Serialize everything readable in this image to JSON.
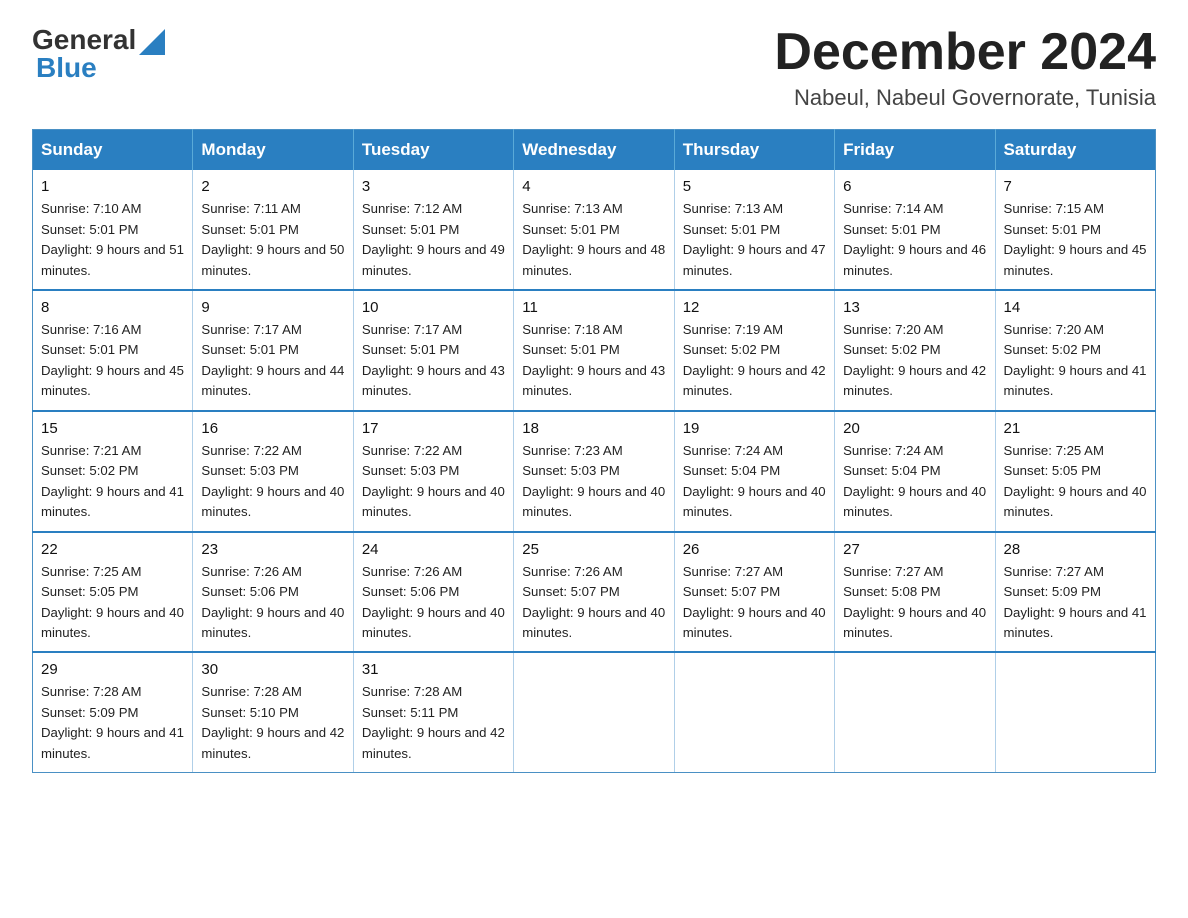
{
  "logo": {
    "text_general": "General",
    "text_blue": "Blue"
  },
  "header": {
    "month_year": "December 2024",
    "location": "Nabeul, Nabeul Governorate, Tunisia"
  },
  "days_of_week": [
    "Sunday",
    "Monday",
    "Tuesday",
    "Wednesday",
    "Thursday",
    "Friday",
    "Saturday"
  ],
  "weeks": [
    [
      {
        "day": "1",
        "sunrise": "Sunrise: 7:10 AM",
        "sunset": "Sunset: 5:01 PM",
        "daylight": "Daylight: 9 hours and 51 minutes."
      },
      {
        "day": "2",
        "sunrise": "Sunrise: 7:11 AM",
        "sunset": "Sunset: 5:01 PM",
        "daylight": "Daylight: 9 hours and 50 minutes."
      },
      {
        "day": "3",
        "sunrise": "Sunrise: 7:12 AM",
        "sunset": "Sunset: 5:01 PM",
        "daylight": "Daylight: 9 hours and 49 minutes."
      },
      {
        "day": "4",
        "sunrise": "Sunrise: 7:13 AM",
        "sunset": "Sunset: 5:01 PM",
        "daylight": "Daylight: 9 hours and 48 minutes."
      },
      {
        "day": "5",
        "sunrise": "Sunrise: 7:13 AM",
        "sunset": "Sunset: 5:01 PM",
        "daylight": "Daylight: 9 hours and 47 minutes."
      },
      {
        "day": "6",
        "sunrise": "Sunrise: 7:14 AM",
        "sunset": "Sunset: 5:01 PM",
        "daylight": "Daylight: 9 hours and 46 minutes."
      },
      {
        "day": "7",
        "sunrise": "Sunrise: 7:15 AM",
        "sunset": "Sunset: 5:01 PM",
        "daylight": "Daylight: 9 hours and 45 minutes."
      }
    ],
    [
      {
        "day": "8",
        "sunrise": "Sunrise: 7:16 AM",
        "sunset": "Sunset: 5:01 PM",
        "daylight": "Daylight: 9 hours and 45 minutes."
      },
      {
        "day": "9",
        "sunrise": "Sunrise: 7:17 AM",
        "sunset": "Sunset: 5:01 PM",
        "daylight": "Daylight: 9 hours and 44 minutes."
      },
      {
        "day": "10",
        "sunrise": "Sunrise: 7:17 AM",
        "sunset": "Sunset: 5:01 PM",
        "daylight": "Daylight: 9 hours and 43 minutes."
      },
      {
        "day": "11",
        "sunrise": "Sunrise: 7:18 AM",
        "sunset": "Sunset: 5:01 PM",
        "daylight": "Daylight: 9 hours and 43 minutes."
      },
      {
        "day": "12",
        "sunrise": "Sunrise: 7:19 AM",
        "sunset": "Sunset: 5:02 PM",
        "daylight": "Daylight: 9 hours and 42 minutes."
      },
      {
        "day": "13",
        "sunrise": "Sunrise: 7:20 AM",
        "sunset": "Sunset: 5:02 PM",
        "daylight": "Daylight: 9 hours and 42 minutes."
      },
      {
        "day": "14",
        "sunrise": "Sunrise: 7:20 AM",
        "sunset": "Sunset: 5:02 PM",
        "daylight": "Daylight: 9 hours and 41 minutes."
      }
    ],
    [
      {
        "day": "15",
        "sunrise": "Sunrise: 7:21 AM",
        "sunset": "Sunset: 5:02 PM",
        "daylight": "Daylight: 9 hours and 41 minutes."
      },
      {
        "day": "16",
        "sunrise": "Sunrise: 7:22 AM",
        "sunset": "Sunset: 5:03 PM",
        "daylight": "Daylight: 9 hours and 40 minutes."
      },
      {
        "day": "17",
        "sunrise": "Sunrise: 7:22 AM",
        "sunset": "Sunset: 5:03 PM",
        "daylight": "Daylight: 9 hours and 40 minutes."
      },
      {
        "day": "18",
        "sunrise": "Sunrise: 7:23 AM",
        "sunset": "Sunset: 5:03 PM",
        "daylight": "Daylight: 9 hours and 40 minutes."
      },
      {
        "day": "19",
        "sunrise": "Sunrise: 7:24 AM",
        "sunset": "Sunset: 5:04 PM",
        "daylight": "Daylight: 9 hours and 40 minutes."
      },
      {
        "day": "20",
        "sunrise": "Sunrise: 7:24 AM",
        "sunset": "Sunset: 5:04 PM",
        "daylight": "Daylight: 9 hours and 40 minutes."
      },
      {
        "day": "21",
        "sunrise": "Sunrise: 7:25 AM",
        "sunset": "Sunset: 5:05 PM",
        "daylight": "Daylight: 9 hours and 40 minutes."
      }
    ],
    [
      {
        "day": "22",
        "sunrise": "Sunrise: 7:25 AM",
        "sunset": "Sunset: 5:05 PM",
        "daylight": "Daylight: 9 hours and 40 minutes."
      },
      {
        "day": "23",
        "sunrise": "Sunrise: 7:26 AM",
        "sunset": "Sunset: 5:06 PM",
        "daylight": "Daylight: 9 hours and 40 minutes."
      },
      {
        "day": "24",
        "sunrise": "Sunrise: 7:26 AM",
        "sunset": "Sunset: 5:06 PM",
        "daylight": "Daylight: 9 hours and 40 minutes."
      },
      {
        "day": "25",
        "sunrise": "Sunrise: 7:26 AM",
        "sunset": "Sunset: 5:07 PM",
        "daylight": "Daylight: 9 hours and 40 minutes."
      },
      {
        "day": "26",
        "sunrise": "Sunrise: 7:27 AM",
        "sunset": "Sunset: 5:07 PM",
        "daylight": "Daylight: 9 hours and 40 minutes."
      },
      {
        "day": "27",
        "sunrise": "Sunrise: 7:27 AM",
        "sunset": "Sunset: 5:08 PM",
        "daylight": "Daylight: 9 hours and 40 minutes."
      },
      {
        "day": "28",
        "sunrise": "Sunrise: 7:27 AM",
        "sunset": "Sunset: 5:09 PM",
        "daylight": "Daylight: 9 hours and 41 minutes."
      }
    ],
    [
      {
        "day": "29",
        "sunrise": "Sunrise: 7:28 AM",
        "sunset": "Sunset: 5:09 PM",
        "daylight": "Daylight: 9 hours and 41 minutes."
      },
      {
        "day": "30",
        "sunrise": "Sunrise: 7:28 AM",
        "sunset": "Sunset: 5:10 PM",
        "daylight": "Daylight: 9 hours and 42 minutes."
      },
      {
        "day": "31",
        "sunrise": "Sunrise: 7:28 AM",
        "sunset": "Sunset: 5:11 PM",
        "daylight": "Daylight: 9 hours and 42 minutes."
      },
      null,
      null,
      null,
      null
    ]
  ]
}
